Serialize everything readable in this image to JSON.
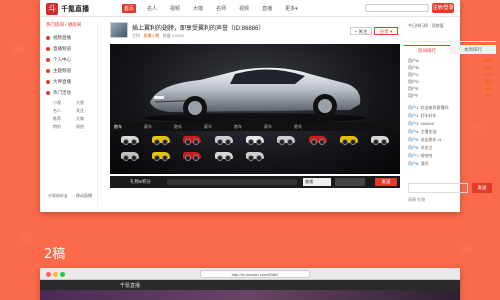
{
  "site": {
    "logo_mark": "斗",
    "logo_text": "千氪直播"
  },
  "nav": {
    "items": [
      "首页",
      "名人",
      "视频",
      "大咖",
      "名师",
      "视频",
      "直播",
      "更多▾"
    ],
    "active": 0
  },
  "header": {
    "register_label": "注册/登录"
  },
  "sidebar": {
    "top_link": "热门房间 / 进房间",
    "items": [
      "视频直播",
      "直播频道",
      "个人中心",
      "主题频道",
      "大神直播",
      "热门活动"
    ],
    "sub_items": [
      "小视",
      "大视",
      "名人",
      "关注",
      "推荐",
      "大咖",
      "特别",
      "原创"
    ],
    "foot": [
      "分享给好友",
      "移动直播"
    ]
  },
  "room": {
    "title": "插上翼利的翅膀，即享受翼利的声誉（ID:86886）",
    "meta_host": "主持",
    "meta_count": "直播人数",
    "meta_hot": "热度 0.0000",
    "follow_label": "+ 关注",
    "share_label": "分享 ▾"
  },
  "player_tabs": [
    "跑车",
    "豪车",
    "跑车",
    "豪车",
    "跑车",
    "豪车",
    "跑车"
  ],
  "gift_colors": [
    "#d8d8d8",
    "#e8c400",
    "#c81e1e",
    "#d0d0d0",
    "#e8e8e8",
    "#d0d0d0",
    "#c81e1e",
    "#e6c000",
    "#d8d8d8",
    "#c0c0c0",
    "#e8c400",
    "#c81e1e",
    "#d8d8d8",
    "#cfcfcf"
  ],
  "controls": {
    "gift_label": "礼物&积分",
    "select_label": "普通",
    "send_label": "发送"
  },
  "right": {
    "top_text": "今日排行榜 · 贡献值",
    "tabs": [
      "房间排行",
      "本周排行"
    ],
    "ranks": [
      {
        "name": "用户A",
        "value": "1000"
      },
      {
        "name": "用户B",
        "value": "800"
      },
      {
        "name": "用户C",
        "value": "600"
      },
      {
        "name": "用户D",
        "value": "500"
      },
      {
        "name": "用户E",
        "value": "400"
      },
      {
        "name": "用户F",
        "value": "300"
      }
    ],
    "chat": [
      {
        "name": "用户1:",
        "text": "欢迎来到直播间"
      },
      {
        "name": "用户2:",
        "text": "好车好车"
      },
      {
        "name": "用户3:",
        "text": "666666"
      },
      {
        "name": "用户4:",
        "text": "主播加油"
      },
      {
        "name": "用户5:",
        "text": "送出跑车 x1"
      },
      {
        "name": "用户6:",
        "text": "求关注"
      },
      {
        "name": "用户7:",
        "text": "哈哈哈"
      },
      {
        "name": "用户8:",
        "text": "漂亮"
      }
    ],
    "send_label": "发送",
    "bottom_text": "表情  礼物"
  },
  "section2": {
    "label": "2稿"
  },
  "browser": {
    "url": "http://tv.domain.com/8080/",
    "nav_title": "千氪直播"
  }
}
